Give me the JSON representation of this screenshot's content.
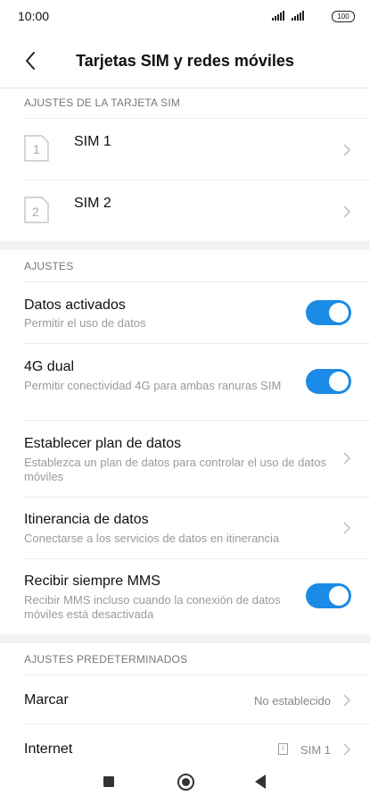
{
  "status_bar": {
    "time": "10:00",
    "battery": "100"
  },
  "header": {
    "title": "Tarjetas SIM y redes móviles"
  },
  "sim_section": {
    "label": "AJUSTES DE LA TARJETA SIM",
    "items": [
      {
        "number": "1",
        "label": "SIM 1"
      },
      {
        "number": "2",
        "label": "SIM 2"
      }
    ]
  },
  "settings_section": {
    "label": "AJUSTES",
    "items": [
      {
        "title": "Datos activados",
        "subtitle": "Permitir el uso de datos",
        "toggle": true
      },
      {
        "title": "4G dual",
        "subtitle": "Permitir conectividad 4G para ambas ranuras SIM",
        "toggle": true
      },
      {
        "title": "Establecer plan de datos",
        "subtitle": "Establezca un plan de datos para controlar el uso de datos móviles"
      },
      {
        "title": "Itinerancia de datos",
        "subtitle": "Conectarse a los servicios de datos en itinerancia"
      },
      {
        "title": "Recibir siempre MMS",
        "subtitle": "Recibir MMS incluso cuando la conexión de datos móviles está desactivada",
        "toggle": true
      }
    ]
  },
  "defaults_section": {
    "label": "AJUSTES PREDETERMINADOS",
    "items": [
      {
        "title": "Marcar",
        "value": "No establecido"
      },
      {
        "title": "Internet",
        "value": "SIM 1",
        "badge": "1"
      }
    ]
  },
  "colors": {
    "accent": "#1a8be6",
    "section_bg": "#f2f2f2"
  }
}
